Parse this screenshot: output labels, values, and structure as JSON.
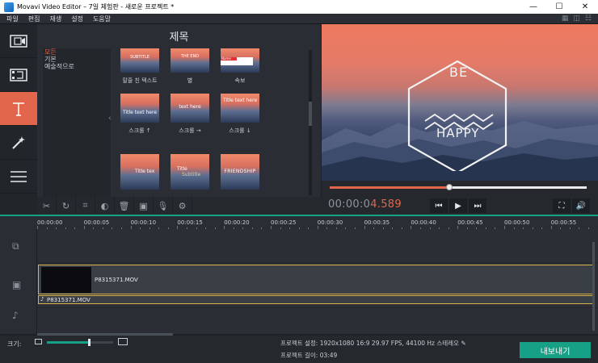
{
  "window": {
    "title": "Movavi Video Editor – 7일 체험판 - 새로운 프로젝트 *",
    "controls": [
      "—",
      "☐",
      "✕"
    ]
  },
  "menu": {
    "items": [
      "파일",
      "편집",
      "재생",
      "설정",
      "도움말"
    ]
  },
  "sidebar": {
    "items": [
      {
        "name": "import-media",
        "icon": "film-icon"
      },
      {
        "name": "filters",
        "icon": "filter-icon"
      },
      {
        "name": "titles",
        "icon": "title-T-icon",
        "active": true
      },
      {
        "name": "transitions",
        "icon": "magic-wand-icon"
      },
      {
        "name": "more",
        "icon": "menu-icon"
      }
    ]
  },
  "panel": {
    "title": "제목",
    "categories": [
      "모든",
      "기본",
      "예술적으로"
    ],
    "selected_category": "모든",
    "thumbnails": [
      {
        "label": "말줄 친 텍스트",
        "overlay": "SUBTITLE"
      },
      {
        "label": "별",
        "overlay": "THE END"
      },
      {
        "label": "속보",
        "overlay": "Name"
      },
      {
        "label": "스크롤 ↑",
        "overlay": "Title text here"
      },
      {
        "label": "스크롤 →",
        "overlay": "text here"
      },
      {
        "label": "스크롤 ↓",
        "overlay": "Title text here"
      },
      {
        "label": "",
        "overlay": "Title tex"
      },
      {
        "label": "",
        "overlay": "Title",
        "overlay2": "Subtitle"
      },
      {
        "label": "",
        "overlay": "FRIENDSHIP"
      }
    ]
  },
  "preview": {
    "line1": "BE",
    "line2": "HAPPY",
    "progress": 0.465
  },
  "transport": {
    "timecode_prefix": "00:00:0",
    "timecode_highlight": "4.589"
  },
  "timeline": {
    "ticks": [
      "00:00:00",
      "00:00:05",
      "00:00:10",
      "00:00:15",
      "00:00:20",
      "00:00:25",
      "00:00:30",
      "00:00:35",
      "00:00:40",
      "00:00:45",
      "00:00:50",
      "00:00:55"
    ],
    "video_clip": "P8315371.MOV",
    "audio_clip": "P8315371.MOV"
  },
  "status": {
    "zoom_label": "크기:",
    "zoom_level": 0.63,
    "project_settings": "프로젝트 설정:  1920x1080 16:9 29.97 FPS, 44100 Hz 스테레오",
    "project_length": "프로젝트 길이:  03:49",
    "export_label": "내보내기"
  },
  "colors": {
    "accent": "#e2664c",
    "export": "#16a085",
    "clip_border": "#d6b24d"
  }
}
